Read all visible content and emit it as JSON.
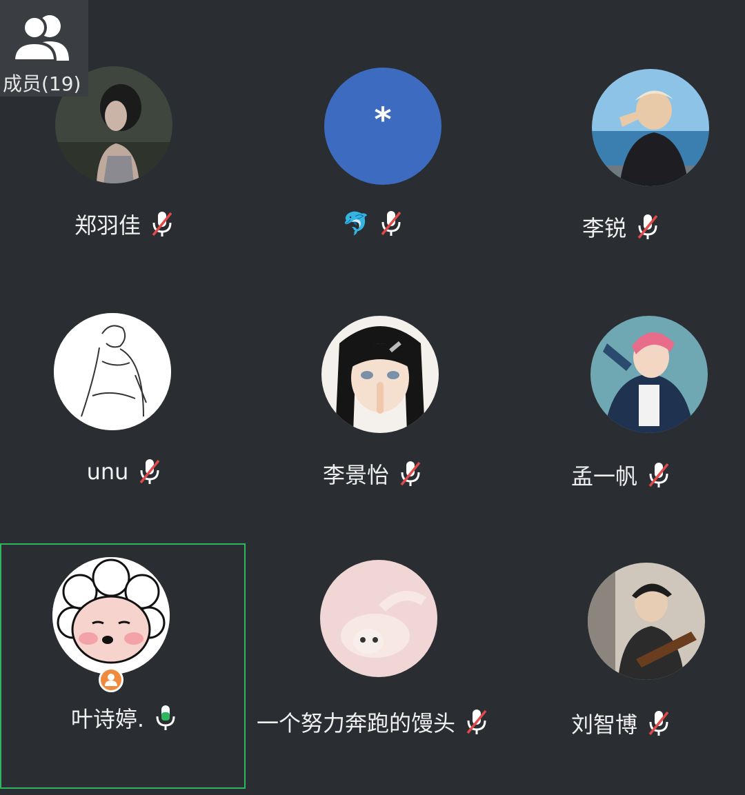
{
  "members_button": {
    "label": "成员(19)"
  },
  "participants": [
    {
      "name": "郑羽佳",
      "mic": "muted",
      "avatar": "photo-girl-dark"
    },
    {
      "name": "🐬",
      "mic": "muted",
      "avatar": "placeholder-asterisk",
      "avatar_text": "*",
      "avatar_color": "#3c6bc0"
    },
    {
      "name": "李锐",
      "mic": "muted",
      "avatar": "photo-boy-sea"
    },
    {
      "name": "unu",
      "mic": "muted",
      "avatar": "sketch-boy"
    },
    {
      "name": "李景怡",
      "mic": "muted",
      "avatar": "anime-girl"
    },
    {
      "name": "孟一帆",
      "mic": "muted",
      "avatar": "anime-boy-pink-hair"
    },
    {
      "name": "叶诗婷.",
      "mic": "active",
      "avatar": "cartoon-sheep",
      "host": true
    },
    {
      "name": "一个努力奔跑的馒头",
      "mic": "muted",
      "avatar": "photo-cat-pink"
    },
    {
      "name": "刘智博",
      "mic": "muted",
      "avatar": "photo-boy-guitar"
    }
  ],
  "colors": {
    "background": "#2a2d31",
    "active_border": "#2fb55d",
    "mic_active": "#2fb55d",
    "mic_muted_slash": "#e04a4a",
    "host_badge": "#f08a3c"
  }
}
